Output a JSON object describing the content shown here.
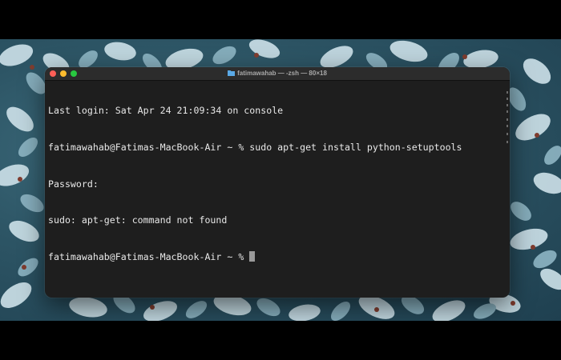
{
  "window": {
    "title": "fatimawahab — -zsh — 80×18",
    "folder_icon": "folder-icon"
  },
  "terminal": {
    "lines": [
      "Last login: Sat Apr 24 21:09:34 on console",
      "fatimawahab@Fatimas-MacBook-Air ~ % sudo apt-get install python-setuptools",
      "Password:",
      "sudo: apt-get: command not found",
      "fatimawahab@Fatimas-MacBook-Air ~ % "
    ],
    "cursor": "block-cursor"
  },
  "colors": {
    "terminal_bg": "#1e1e1e",
    "titlebar_bg": "#2c2c2c",
    "text": "#e8e8e8",
    "close": "#fe5f57",
    "minimize": "#febc2e",
    "zoom": "#28c840",
    "folder": "#5aa9e6"
  }
}
